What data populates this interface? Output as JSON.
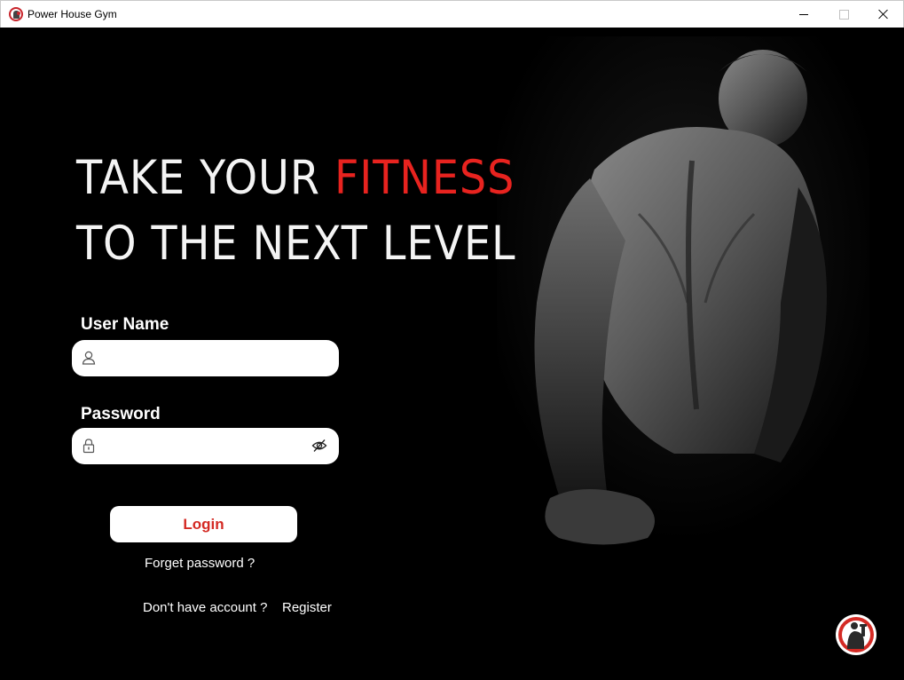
{
  "window": {
    "title": "Power House Gym"
  },
  "hero": {
    "line1_part1": "TAKE YOUR ",
    "line1_accent": "FITNESS",
    "line2": "TO THE NEXT LEVEL"
  },
  "form": {
    "username_label": "User Name",
    "username_value": "",
    "password_label": "Password",
    "password_value": "",
    "login_label": "Login",
    "forget_label": "Forget password ?",
    "no_account_label": "Don't have account ?",
    "register_label": "Register"
  },
  "colors": {
    "accent": "#e8231f",
    "button_text": "#d42a24",
    "background": "#000000"
  },
  "icons": {
    "username": "user-icon",
    "password": "lock-icon",
    "toggle_visibility": "eye-slash-icon",
    "logo": "gym-logo-icon"
  }
}
